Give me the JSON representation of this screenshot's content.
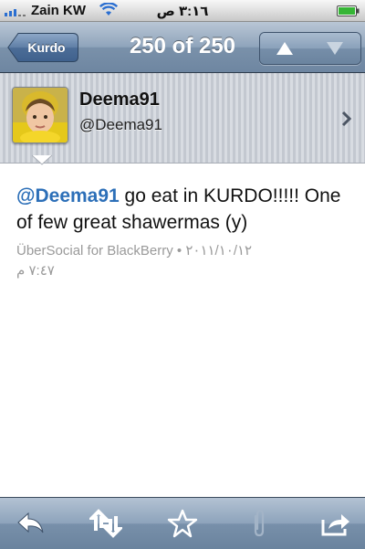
{
  "status_bar": {
    "carrier": "Zain KW",
    "time": "٣:١٦ ص",
    "icons": [
      "signal-bars-icon",
      "wifi-icon",
      "battery-icon"
    ]
  },
  "nav": {
    "back_label": "Kurdo",
    "title": "250 of 250",
    "icons": [
      "up-arrow-icon",
      "down-arrow-icon"
    ]
  },
  "profile": {
    "display_name": "Deema91",
    "username": "@Deema91",
    "icons": [
      "avatar",
      "chevron-right-icon"
    ]
  },
  "tweet": {
    "mention": "@Deema91",
    "text": " go eat in KURDO!!!!! One of few great shawermas (y)",
    "source": "ÜberSocial for BlackBerry",
    "separator": " • ",
    "date": "٢٠١١/١٠/١٢",
    "time": "٧:٤٧ م"
  },
  "toolbar": {
    "icons": [
      "reply-icon",
      "retweet-icon",
      "favorite-star-icon",
      "attach-paperclip-icon",
      "share-icon"
    ]
  },
  "colors": {
    "accent_link": "#2c6fb8",
    "nav_bar": "#7a91aa",
    "meta_text": "#9a9a9a"
  }
}
